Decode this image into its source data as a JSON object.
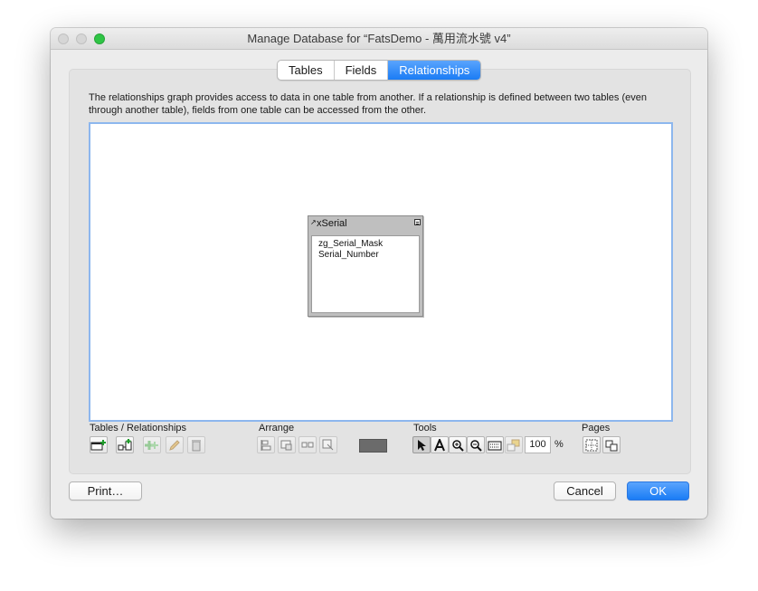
{
  "window": {
    "title": "Manage Database for “FatsDemo - 萬用流水號 v4”"
  },
  "tabs": [
    {
      "label": "Tables",
      "active": false
    },
    {
      "label": "Fields",
      "active": false
    },
    {
      "label": "Relationships",
      "active": true
    }
  ],
  "description": "The relationships graph provides access to data in one table from another. If a relationship is defined between two tables (even through another table), fields from one table can be accessed from the other.",
  "graph": {
    "table": {
      "name": "xSerial",
      "fields": [
        "zg_Serial_Mask",
        "Serial_Number"
      ]
    }
  },
  "toolbar": {
    "tables_relationships_label": "Tables / Relationships",
    "arrange_label": "Arrange",
    "tools_label": "Tools",
    "pages_label": "Pages",
    "zoom_value": "100",
    "zoom_unit": "%",
    "color_well": "#6b6b6b"
  },
  "buttons": {
    "print": "Print…",
    "cancel": "Cancel",
    "ok": "OK"
  },
  "colors": {
    "accent": "#1a7cf5",
    "graph_border": "#8db7ee",
    "zoom_button": "#2fc545"
  }
}
